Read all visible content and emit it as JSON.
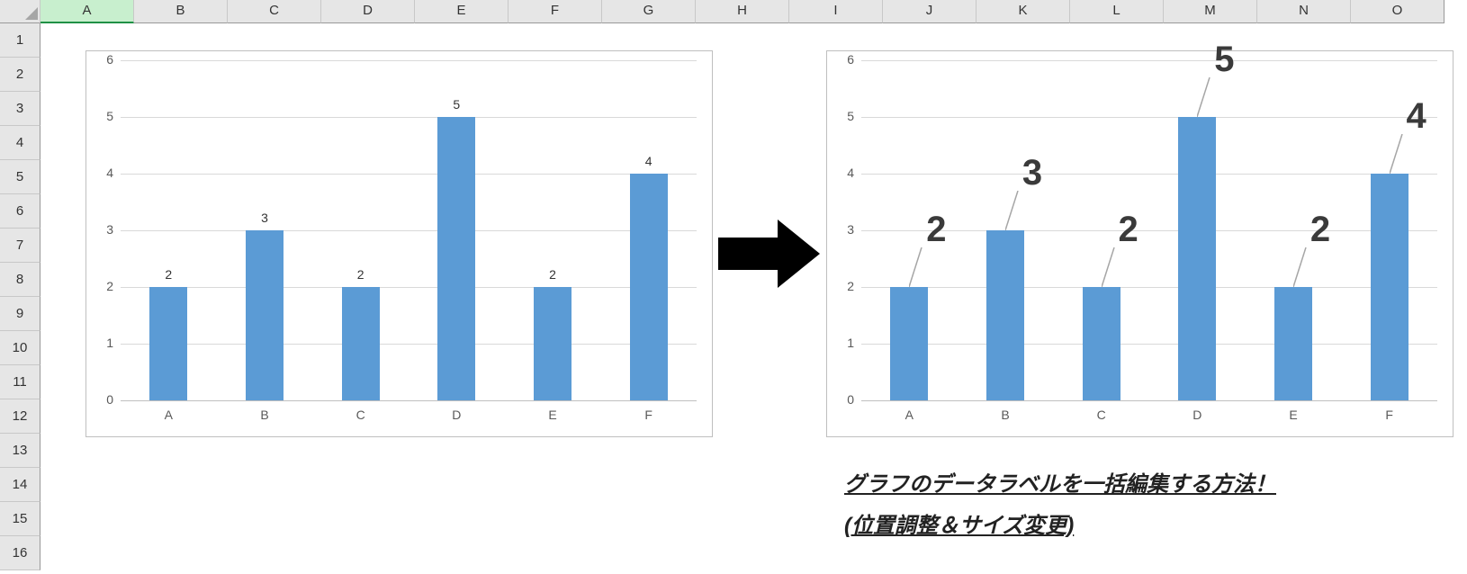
{
  "grid": {
    "columns": [
      "A",
      "B",
      "C",
      "D",
      "E",
      "F",
      "G",
      "H",
      "I",
      "J",
      "K",
      "L",
      "M",
      "N",
      "O"
    ],
    "rows": [
      "1",
      "2",
      "3",
      "4",
      "5",
      "6",
      "7",
      "8",
      "9",
      "10",
      "11",
      "12",
      "13",
      "14",
      "15",
      "16"
    ],
    "active_column": "A"
  },
  "chart_data": [
    {
      "type": "bar",
      "title": "",
      "xlabel": "",
      "ylabel": "",
      "ylim": [
        0,
        6
      ],
      "yticks": [
        0,
        1,
        2,
        3,
        4,
        5,
        6
      ],
      "categories": [
        "A",
        "B",
        "C",
        "D",
        "E",
        "F"
      ],
      "values": [
        2,
        3,
        2,
        5,
        2,
        4
      ],
      "data_labels": {
        "style": "small",
        "labels": [
          "2",
          "3",
          "2",
          "5",
          "2",
          "4"
        ]
      }
    },
    {
      "type": "bar",
      "title": "",
      "xlabel": "",
      "ylabel": "",
      "ylim": [
        0,
        6
      ],
      "yticks": [
        0,
        1,
        2,
        3,
        4,
        5,
        6
      ],
      "categories": [
        "A",
        "B",
        "C",
        "D",
        "E",
        "F"
      ],
      "values": [
        2,
        3,
        2,
        5,
        2,
        4
      ],
      "data_labels": {
        "style": "big-with-leader",
        "labels": [
          "2",
          "3",
          "2",
          "5",
          "2",
          "4"
        ]
      }
    }
  ],
  "caption": {
    "line1": "グラフのデータラベルを一括編集する方法！",
    "line2": "(位置調整＆サイズ変更)"
  },
  "colors": {
    "bar": "#5b9bd5",
    "grid": "#d9d9d9",
    "axis": "#bfbfbf",
    "header_bg": "#e6e6e6",
    "active_col_bg": "#c8efce",
    "active_col_border": "#1f9145"
  }
}
